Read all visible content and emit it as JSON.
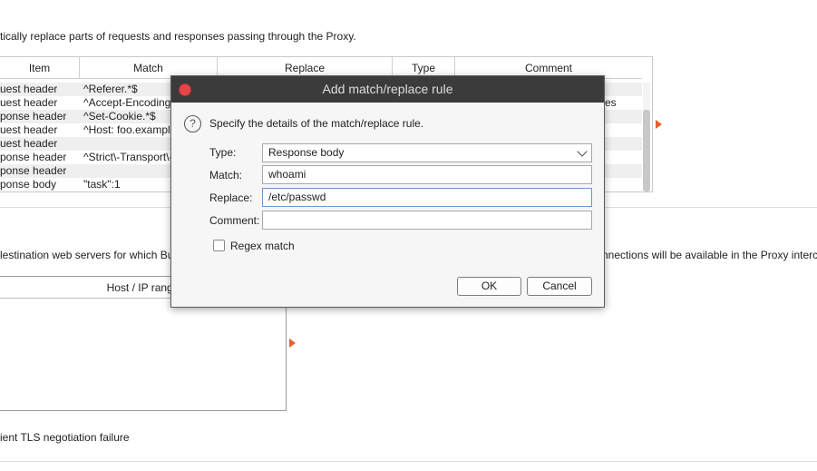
{
  "background": {
    "description_top": "tically replace parts of requests and responses passing through the Proxy.",
    "rules_table": {
      "headers": [
        "Item",
        "Match",
        "Replace",
        "Type",
        "Comment"
      ],
      "rows": [
        {
          "item": "uest header",
          "match": "^Referer.*$"
        },
        {
          "item": "uest header",
          "match": "^Accept-Encoding.*"
        },
        {
          "item": "ponse header",
          "match": "^Set-Cookie.*$"
        },
        {
          "item": "uest header",
          "match": "^Host: foo.example"
        },
        {
          "item": "uest header",
          "match": ""
        },
        {
          "item": "ponse header",
          "match": "^Strict\\-Transport\\-"
        },
        {
          "item": "ponse header",
          "match": ""
        },
        {
          "item": "ponse body",
          "match": "\"task\":1"
        }
      ],
      "comment_fragment": "es"
    },
    "description_mid_left": "lestination web servers for which Burp v",
    "description_mid_right": "nnections will be available in the Proxy intercept v",
    "hosts_table": {
      "header": "Host / IP range"
    },
    "tls_text": "ient TLS negotiation failure",
    "accent_color": "#e8602c"
  },
  "dialog": {
    "title": "Add match/replace rule",
    "help_text": "Specify the details of the match/replace rule.",
    "type_label": "Type:",
    "type_value": "Response body",
    "match_label": "Match:",
    "match_value": "whoami",
    "replace_label": "Replace:",
    "replace_value": "/etc/passwd",
    "comment_label": "Comment:",
    "comment_value": "",
    "regex_label": "Regex match",
    "regex_checked": false,
    "ok_label": "OK",
    "cancel_label": "Cancel"
  }
}
